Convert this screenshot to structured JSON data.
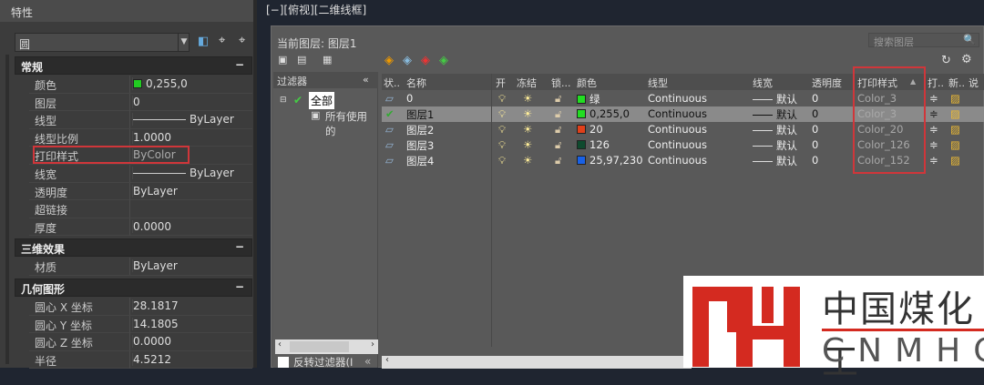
{
  "properties": {
    "title": "特性",
    "selector": "圆",
    "sections": [
      {
        "title": "常规",
        "rows": [
          {
            "label": "颜色",
            "value": "0,255,0",
            "swatch": "#22cc22"
          },
          {
            "label": "图层",
            "value": "0"
          },
          {
            "label": "线型",
            "value": "ByLayer",
            "line": true
          },
          {
            "label": "线型比例",
            "value": "1.0000"
          },
          {
            "label": "打印样式",
            "value": "ByColor",
            "highlight": true
          },
          {
            "label": "线宽",
            "value": "ByLayer",
            "line": true
          },
          {
            "label": "透明度",
            "value": "ByLayer"
          },
          {
            "label": "超链接",
            "value": ""
          },
          {
            "label": "厚度",
            "value": "0.0000"
          }
        ]
      },
      {
        "title": "三维效果",
        "rows": [
          {
            "label": "材质",
            "value": "ByLayer"
          }
        ]
      },
      {
        "title": "几何图形",
        "rows": [
          {
            "label": "圆心 X 坐标",
            "value": "28.1817"
          },
          {
            "label": "圆心 Y 坐标",
            "value": "14.1805"
          },
          {
            "label": "圆心 Z 坐标",
            "value": "0.0000"
          },
          {
            "label": "半径",
            "value": "4.5212"
          }
        ]
      }
    ],
    "collapse": "−"
  },
  "viewport": {
    "label": "[−][俯视][二维线框]"
  },
  "layers": {
    "current": "当前图层: 图层1",
    "search_placeholder": "搜索图层",
    "filter_header": "过滤器",
    "filter_all": "全部",
    "filter_used": "所有使用的",
    "invert_filter": "反转过滤器(I",
    "columns": [
      "状..",
      "名称",
      "开",
      "冻结",
      "锁...",
      "颜色",
      "线型",
      "线宽",
      "透明度",
      "打印样式",
      "打..",
      "新..",
      "说"
    ],
    "rows": [
      {
        "name": "0",
        "color": "绿",
        "swatch": "#22dd22",
        "linetype": "Continuous",
        "lineweight": "默认",
        "transparency": "0",
        "plotstyle": "Color_3",
        "current": false
      },
      {
        "name": "图层1",
        "color": "0,255,0",
        "swatch": "#22dd22",
        "linetype": "Continuous",
        "lineweight": "默认",
        "transparency": "0",
        "plotstyle": "Color_3",
        "current": true
      },
      {
        "name": "图层2",
        "color": "20",
        "swatch": "#e0401a",
        "linetype": "Continuous",
        "lineweight": "默认",
        "transparency": "0",
        "plotstyle": "Color_20",
        "current": false
      },
      {
        "name": "图层3",
        "color": "126",
        "swatch": "#0f4a2e",
        "linetype": "Continuous",
        "lineweight": "默认",
        "transparency": "0",
        "plotstyle": "Color_126",
        "current": false
      },
      {
        "name": "图层4",
        "color": "25,97,230",
        "swatch": "#1961e6",
        "linetype": "Continuous",
        "lineweight": "默认",
        "transparency": "0",
        "plotstyle": "Color_152",
        "current": false
      }
    ]
  },
  "logo": {
    "mark": "MH",
    "cn": "中国煤化工",
    "en": "CNMHG"
  }
}
